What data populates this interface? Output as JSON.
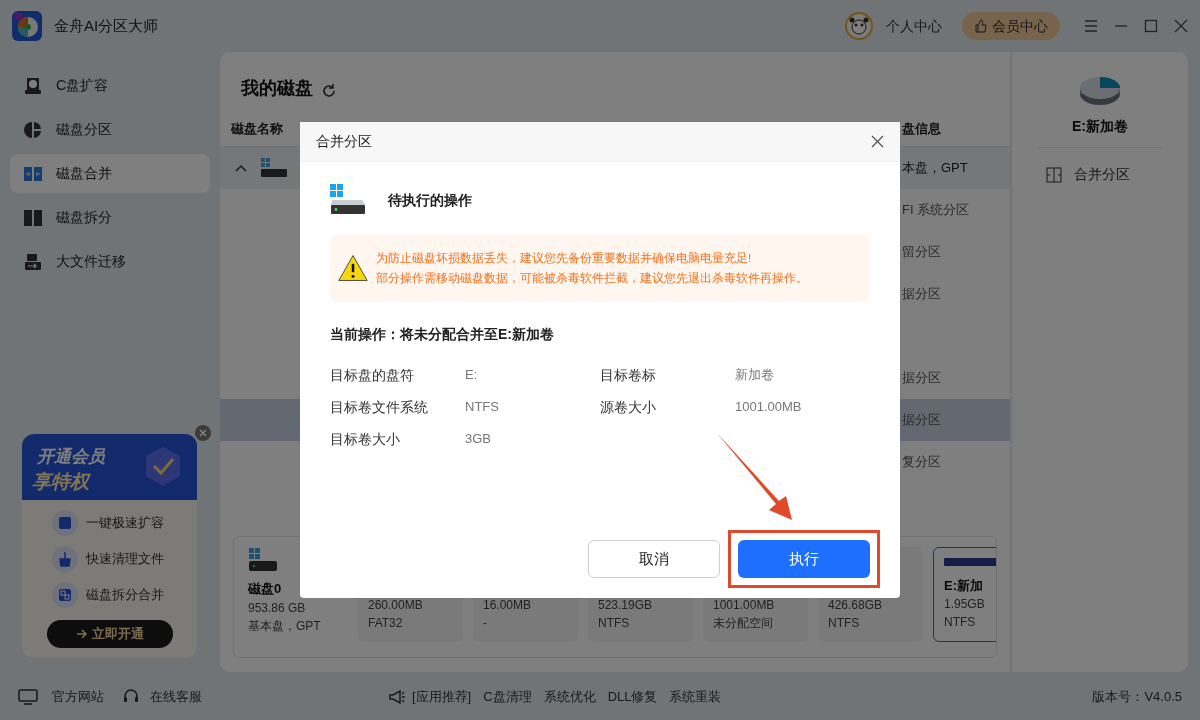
{
  "app": {
    "title": "金舟AI分区大师"
  },
  "header": {
    "user": "个人中心",
    "vip": "会员中心"
  },
  "sidebar": {
    "items": [
      {
        "label": "C盘扩容",
        "selected": false
      },
      {
        "label": "磁盘分区",
        "selected": false
      },
      {
        "label": "磁盘合并",
        "selected": true
      },
      {
        "label": "磁盘拆分",
        "selected": false
      },
      {
        "label": "大文件迁移",
        "selected": false
      }
    ]
  },
  "promo": {
    "title_line1": "开通会员",
    "title_line2": "享特权",
    "features": [
      "一键极速扩容",
      "快速清理文件",
      "磁盘拆分合并"
    ],
    "button": "立即开通"
  },
  "main": {
    "title": "我的磁盘",
    "columns": [
      "磁盘名称",
      "盘信息"
    ],
    "rows": [
      {
        "kind": "disk",
        "expanded": true,
        "info": "本盘，GPT",
        "selected": false
      },
      {
        "kind": "partition",
        "info": "FI 系统分区",
        "selected": false
      },
      {
        "kind": "partition",
        "info": "留分区",
        "selected": false
      },
      {
        "kind": "partition",
        "info": "据分区",
        "selected": false
      },
      {
        "kind": "blank"
      },
      {
        "kind": "partition",
        "info": "据分区",
        "selected": false
      },
      {
        "kind": "partition",
        "info": "据分区",
        "selected": true
      },
      {
        "kind": "partition",
        "info": "复分区",
        "selected": false
      }
    ]
  },
  "disk_strip": {
    "disk": {
      "name": "磁盘0",
      "size": "953.86 GB",
      "type": "基本盘，GPT"
    },
    "partitions": [
      {
        "size": "260.00MB",
        "fs": "FAT32",
        "selected": false
      },
      {
        "size": "16.00MB",
        "fs": "-",
        "selected": false
      },
      {
        "size": "523.19GB",
        "fs": "NTFS",
        "selected": false
      },
      {
        "size": "1001.00MB",
        "fs": "未分配空间",
        "selected": false
      },
      {
        "size": "426.68GB",
        "fs": "NTFS",
        "selected": false
      },
      {
        "label": "E:新加",
        "size": "1.95GB",
        "fs": "NTFS",
        "selected": true
      }
    ]
  },
  "right_panel": {
    "title": "E:新加卷",
    "actions": [
      "合并分区"
    ]
  },
  "dialog": {
    "title": "合并分区",
    "heading": "待执行的操作",
    "warning": [
      "为防止磁盘坏损数据丢失，建议您先备份重要数据并确保电脑电量充足!",
      "部分操作需移动磁盘数据，可能被杀毒软件拦截，建议您先退出杀毒软件再操作。"
    ],
    "current": "当前操作：将未分配合并至E:新加卷",
    "fields": [
      {
        "label": "目标盘的盘符",
        "value": "E:"
      },
      {
        "label": "目标卷标",
        "value": "新加卷"
      },
      {
        "label": "目标卷文件系统",
        "value": "NTFS"
      },
      {
        "label": "源卷大小",
        "value": "1001.00MB"
      },
      {
        "label": "目标卷大小",
        "value": "3GB"
      }
    ],
    "buttons": [
      {
        "label": "取消",
        "kind": "secondary"
      },
      {
        "label": "执行",
        "kind": "primary",
        "highlighted": true
      }
    ]
  },
  "footer": {
    "links": [
      "官方网站",
      "在线客服"
    ],
    "promo_label": "[应用推荐]",
    "promo_links": [
      "C盘清理",
      "系统优化",
      "DLL修复",
      "系统重装"
    ],
    "version": "版本号：V4.0.5"
  }
}
